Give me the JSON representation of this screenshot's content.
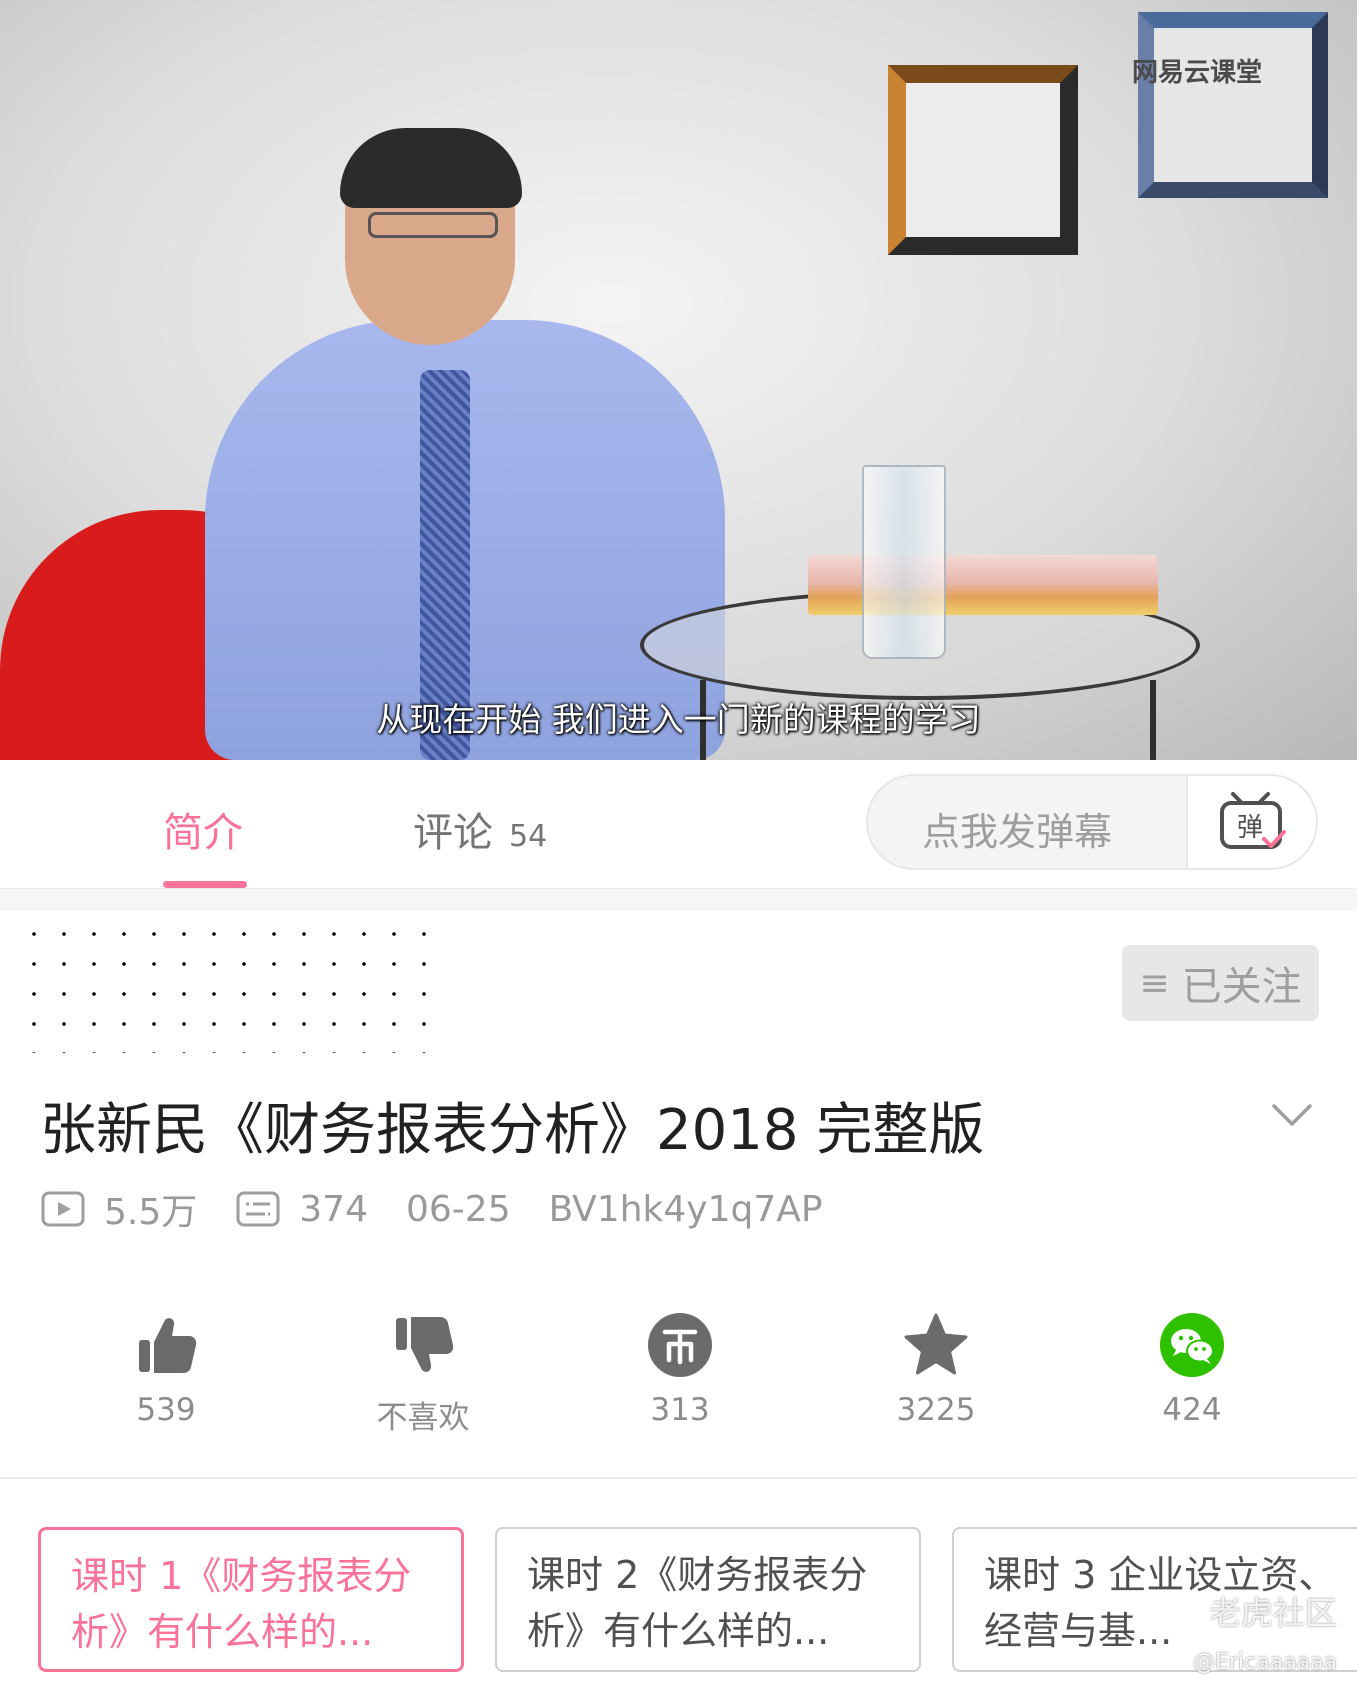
{
  "video": {
    "subtitle": "从现在开始 我们进入一门新的课程的学习",
    "watermark": "网易云课堂"
  },
  "tabs": [
    {
      "label": "简介",
      "active": true
    },
    {
      "label": "评论",
      "count": "54",
      "active": false
    }
  ],
  "danmaku": {
    "placeholder": "点我发弹幕",
    "icon": "danmaku-tv-icon"
  },
  "uploader": {
    "follow_label": "已关注",
    "follow_icon": "menu-icon"
  },
  "video_info": {
    "title": "张新民《财务报表分析》2018  完整版",
    "views": "5.5万",
    "danmaku_count": "374",
    "date": "06-25",
    "bvid": "BV1hk4y1q7AP"
  },
  "actions": [
    {
      "name": "like",
      "icon": "thumbs-up-icon",
      "label": "539"
    },
    {
      "name": "dislike",
      "icon": "thumbs-down-icon",
      "label": "不喜欢"
    },
    {
      "name": "coin",
      "icon": "coin-icon",
      "label": "313"
    },
    {
      "name": "favorite",
      "icon": "star-icon",
      "label": "3225"
    },
    {
      "name": "share",
      "icon": "wechat-icon",
      "label": "424"
    }
  ],
  "episodes": [
    {
      "label": "课时 1《财务报表分析》有什么样的...",
      "active": true
    },
    {
      "label": "课时 2《财务报表分析》有什么样的...",
      "active": false
    },
    {
      "label": "课时 3 企业设立资、经营与基...",
      "active": false
    }
  ],
  "watermarks": {
    "community": "老虎社区",
    "user": "@Ericaaaaaa"
  },
  "colors": {
    "accent": "#fb7299",
    "icon_gray": "#6b6b6b",
    "wechat_green": "#2dc100"
  }
}
